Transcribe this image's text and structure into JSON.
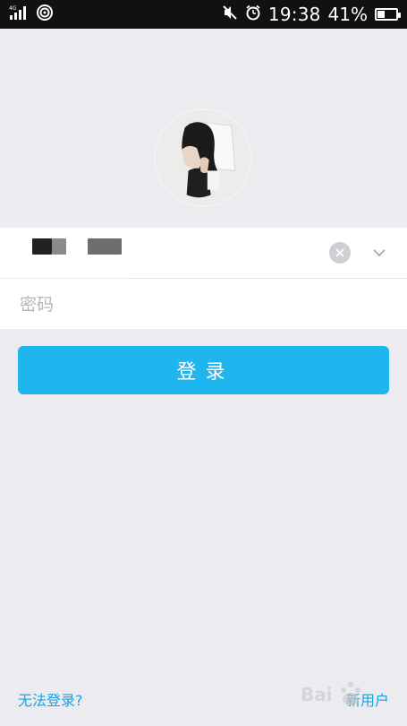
{
  "status_bar": {
    "network": "4G",
    "time": "19:38",
    "battery_percent_label": "41%",
    "battery_level": 0.41,
    "icons": [
      "signal-icon",
      "wifi-icon",
      "mute-icon",
      "alarm-icon",
      "battery-icon"
    ]
  },
  "account": {
    "clear_icon": "clear-icon",
    "dropdown_icon": "chevron-down-icon"
  },
  "password": {
    "placeholder": "密码"
  },
  "login": {
    "button_label": "登录"
  },
  "footer": {
    "forgot_label": "无法登录?",
    "register_label": "新用户"
  },
  "colors": {
    "background": "#ebebf0",
    "accent": "#1fb6f0",
    "link": "#1aa2e0"
  }
}
